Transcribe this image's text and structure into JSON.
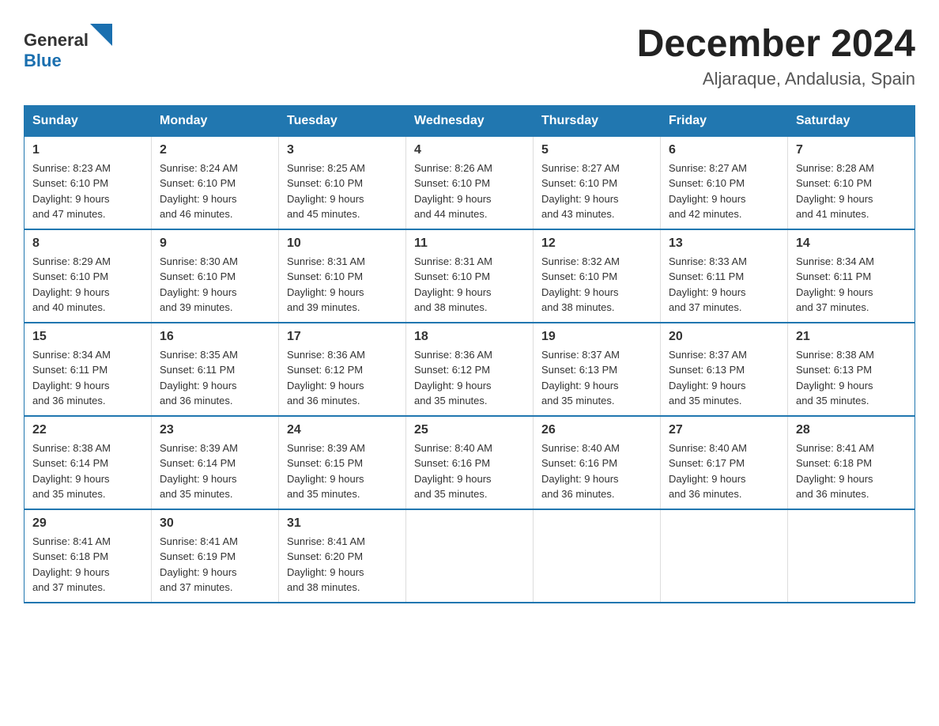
{
  "logo": {
    "text_general": "General",
    "text_blue": "Blue",
    "triangle_color": "#1a6faf"
  },
  "header": {
    "month_title": "December 2024",
    "location": "Aljaraque, Andalusia, Spain"
  },
  "columns": [
    "Sunday",
    "Monday",
    "Tuesday",
    "Wednesday",
    "Thursday",
    "Friday",
    "Saturday"
  ],
  "weeks": [
    [
      {
        "day": "1",
        "sunrise": "8:23 AM",
        "sunset": "6:10 PM",
        "daylight": "9 hours and 47 minutes."
      },
      {
        "day": "2",
        "sunrise": "8:24 AM",
        "sunset": "6:10 PM",
        "daylight": "9 hours and 46 minutes."
      },
      {
        "day": "3",
        "sunrise": "8:25 AM",
        "sunset": "6:10 PM",
        "daylight": "9 hours and 45 minutes."
      },
      {
        "day": "4",
        "sunrise": "8:26 AM",
        "sunset": "6:10 PM",
        "daylight": "9 hours and 44 minutes."
      },
      {
        "day": "5",
        "sunrise": "8:27 AM",
        "sunset": "6:10 PM",
        "daylight": "9 hours and 43 minutes."
      },
      {
        "day": "6",
        "sunrise": "8:27 AM",
        "sunset": "6:10 PM",
        "daylight": "9 hours and 42 minutes."
      },
      {
        "day": "7",
        "sunrise": "8:28 AM",
        "sunset": "6:10 PM",
        "daylight": "9 hours and 41 minutes."
      }
    ],
    [
      {
        "day": "8",
        "sunrise": "8:29 AM",
        "sunset": "6:10 PM",
        "daylight": "9 hours and 40 minutes."
      },
      {
        "day": "9",
        "sunrise": "8:30 AM",
        "sunset": "6:10 PM",
        "daylight": "9 hours and 39 minutes."
      },
      {
        "day": "10",
        "sunrise": "8:31 AM",
        "sunset": "6:10 PM",
        "daylight": "9 hours and 39 minutes."
      },
      {
        "day": "11",
        "sunrise": "8:31 AM",
        "sunset": "6:10 PM",
        "daylight": "9 hours and 38 minutes."
      },
      {
        "day": "12",
        "sunrise": "8:32 AM",
        "sunset": "6:10 PM",
        "daylight": "9 hours and 38 minutes."
      },
      {
        "day": "13",
        "sunrise": "8:33 AM",
        "sunset": "6:11 PM",
        "daylight": "9 hours and 37 minutes."
      },
      {
        "day": "14",
        "sunrise": "8:34 AM",
        "sunset": "6:11 PM",
        "daylight": "9 hours and 37 minutes."
      }
    ],
    [
      {
        "day": "15",
        "sunrise": "8:34 AM",
        "sunset": "6:11 PM",
        "daylight": "9 hours and 36 minutes."
      },
      {
        "day": "16",
        "sunrise": "8:35 AM",
        "sunset": "6:11 PM",
        "daylight": "9 hours and 36 minutes."
      },
      {
        "day": "17",
        "sunrise": "8:36 AM",
        "sunset": "6:12 PM",
        "daylight": "9 hours and 36 minutes."
      },
      {
        "day": "18",
        "sunrise": "8:36 AM",
        "sunset": "6:12 PM",
        "daylight": "9 hours and 35 minutes."
      },
      {
        "day": "19",
        "sunrise": "8:37 AM",
        "sunset": "6:13 PM",
        "daylight": "9 hours and 35 minutes."
      },
      {
        "day": "20",
        "sunrise": "8:37 AM",
        "sunset": "6:13 PM",
        "daylight": "9 hours and 35 minutes."
      },
      {
        "day": "21",
        "sunrise": "8:38 AM",
        "sunset": "6:13 PM",
        "daylight": "9 hours and 35 minutes."
      }
    ],
    [
      {
        "day": "22",
        "sunrise": "8:38 AM",
        "sunset": "6:14 PM",
        "daylight": "9 hours and 35 minutes."
      },
      {
        "day": "23",
        "sunrise": "8:39 AM",
        "sunset": "6:14 PM",
        "daylight": "9 hours and 35 minutes."
      },
      {
        "day": "24",
        "sunrise": "8:39 AM",
        "sunset": "6:15 PM",
        "daylight": "9 hours and 35 minutes."
      },
      {
        "day": "25",
        "sunrise": "8:40 AM",
        "sunset": "6:16 PM",
        "daylight": "9 hours and 35 minutes."
      },
      {
        "day": "26",
        "sunrise": "8:40 AM",
        "sunset": "6:16 PM",
        "daylight": "9 hours and 36 minutes."
      },
      {
        "day": "27",
        "sunrise": "8:40 AM",
        "sunset": "6:17 PM",
        "daylight": "9 hours and 36 minutes."
      },
      {
        "day": "28",
        "sunrise": "8:41 AM",
        "sunset": "6:18 PM",
        "daylight": "9 hours and 36 minutes."
      }
    ],
    [
      {
        "day": "29",
        "sunrise": "8:41 AM",
        "sunset": "6:18 PM",
        "daylight": "9 hours and 37 minutes."
      },
      {
        "day": "30",
        "sunrise": "8:41 AM",
        "sunset": "6:19 PM",
        "daylight": "9 hours and 37 minutes."
      },
      {
        "day": "31",
        "sunrise": "8:41 AM",
        "sunset": "6:20 PM",
        "daylight": "9 hours and 38 minutes."
      },
      null,
      null,
      null,
      null
    ]
  ]
}
